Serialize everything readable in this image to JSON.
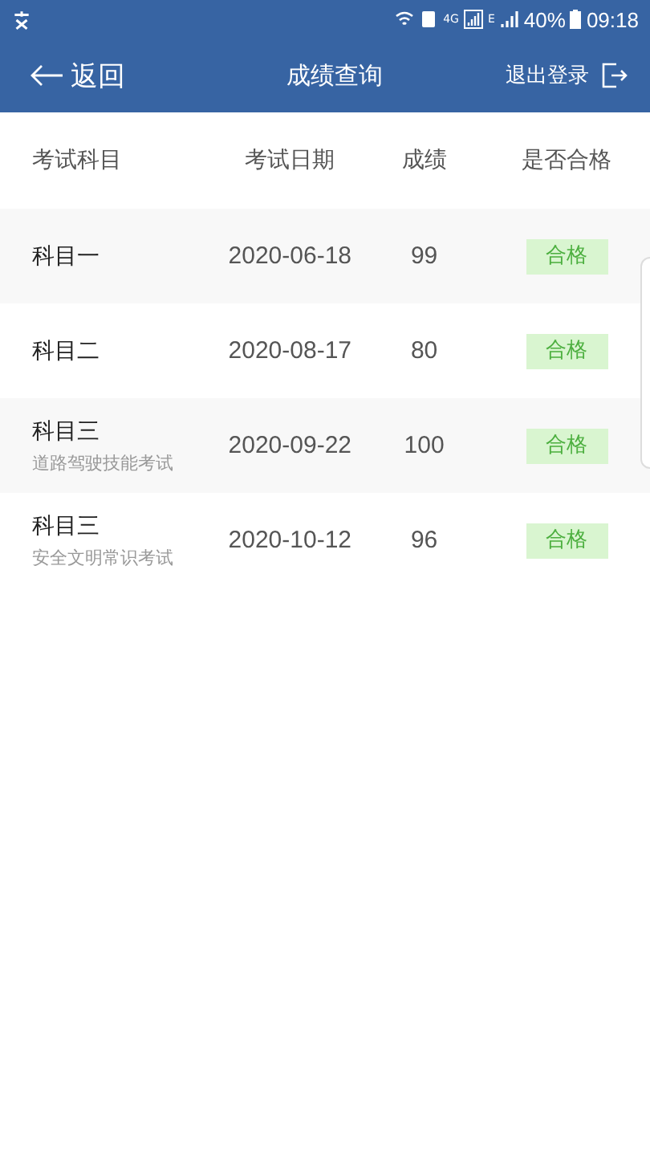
{
  "status_bar": {
    "network": "4G",
    "network_2": "E",
    "battery": "40%",
    "time": "09:18"
  },
  "nav": {
    "back": "返回",
    "title": "成绩查询",
    "logout": "退出登录"
  },
  "table": {
    "columns": [
      "考试科目",
      "考试日期",
      "成绩",
      "是否合格"
    ],
    "rows": [
      {
        "subject": "科目一",
        "date": "2020-06-18",
        "score": "99",
        "result": "合格",
        "passed": true
      },
      {
        "subject": "科目二",
        "date": "2020-08-17",
        "score": "80",
        "result": "合格",
        "passed": true
      },
      {
        "subject": "科目三",
        "detail": "道路驾驶技能考试",
        "date": "2020-09-22",
        "score": "100",
        "result": "合格",
        "passed": true
      },
      {
        "subject": "科目三",
        "detail": "安全文明常识考试",
        "date": "2020-10-12",
        "score": "96",
        "result": "合格",
        "passed": true
      }
    ]
  }
}
